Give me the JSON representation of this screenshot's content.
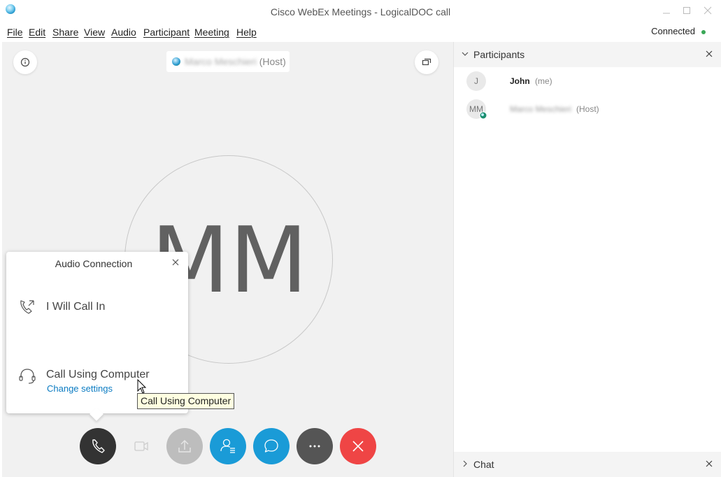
{
  "window": {
    "title": "Cisco WebEx Meetings - LogicalDOC call",
    "controls": [
      "minimize-icon",
      "maximize-icon",
      "close-icon"
    ]
  },
  "menu": {
    "items": [
      "File",
      "Edit",
      "Share",
      "View",
      "Audio",
      "Participant",
      "Meeting",
      "Help"
    ],
    "status": "Connected",
    "status_color": "#3aa757"
  },
  "stage": {
    "host_name": "Marco Meschieri",
    "host_tag": "(Host)",
    "avatar_initials": "MM"
  },
  "audio_popup": {
    "title": "Audio Connection",
    "option_call_in": "I Will Call In",
    "option_computer": "Call Using Computer",
    "change_settings": "Change settings"
  },
  "tooltip": "Call Using Computer",
  "controls": [
    {
      "name": "audio",
      "icon": "phone-icon",
      "color": "#333333"
    },
    {
      "name": "video",
      "icon": "video-icon",
      "color": "#f1f1f1"
    },
    {
      "name": "share",
      "icon": "share-icon",
      "color": "#bdbdbd"
    },
    {
      "name": "participants",
      "icon": "participants-icon",
      "color": "#1a9bd7"
    },
    {
      "name": "chat",
      "icon": "chat-icon",
      "color": "#1a9bd7"
    },
    {
      "name": "more",
      "icon": "more-icon",
      "color": "#555555"
    },
    {
      "name": "leave",
      "icon": "close-icon",
      "color": "#ef4545"
    }
  ],
  "participants_panel": {
    "title": "Participants",
    "list": [
      {
        "initials": "J",
        "name": "John",
        "tag": "(me)"
      },
      {
        "initials": "MM",
        "name": "Marco Meschieri",
        "tag": "(Host)"
      }
    ]
  },
  "chat_panel": {
    "title": "Chat"
  }
}
